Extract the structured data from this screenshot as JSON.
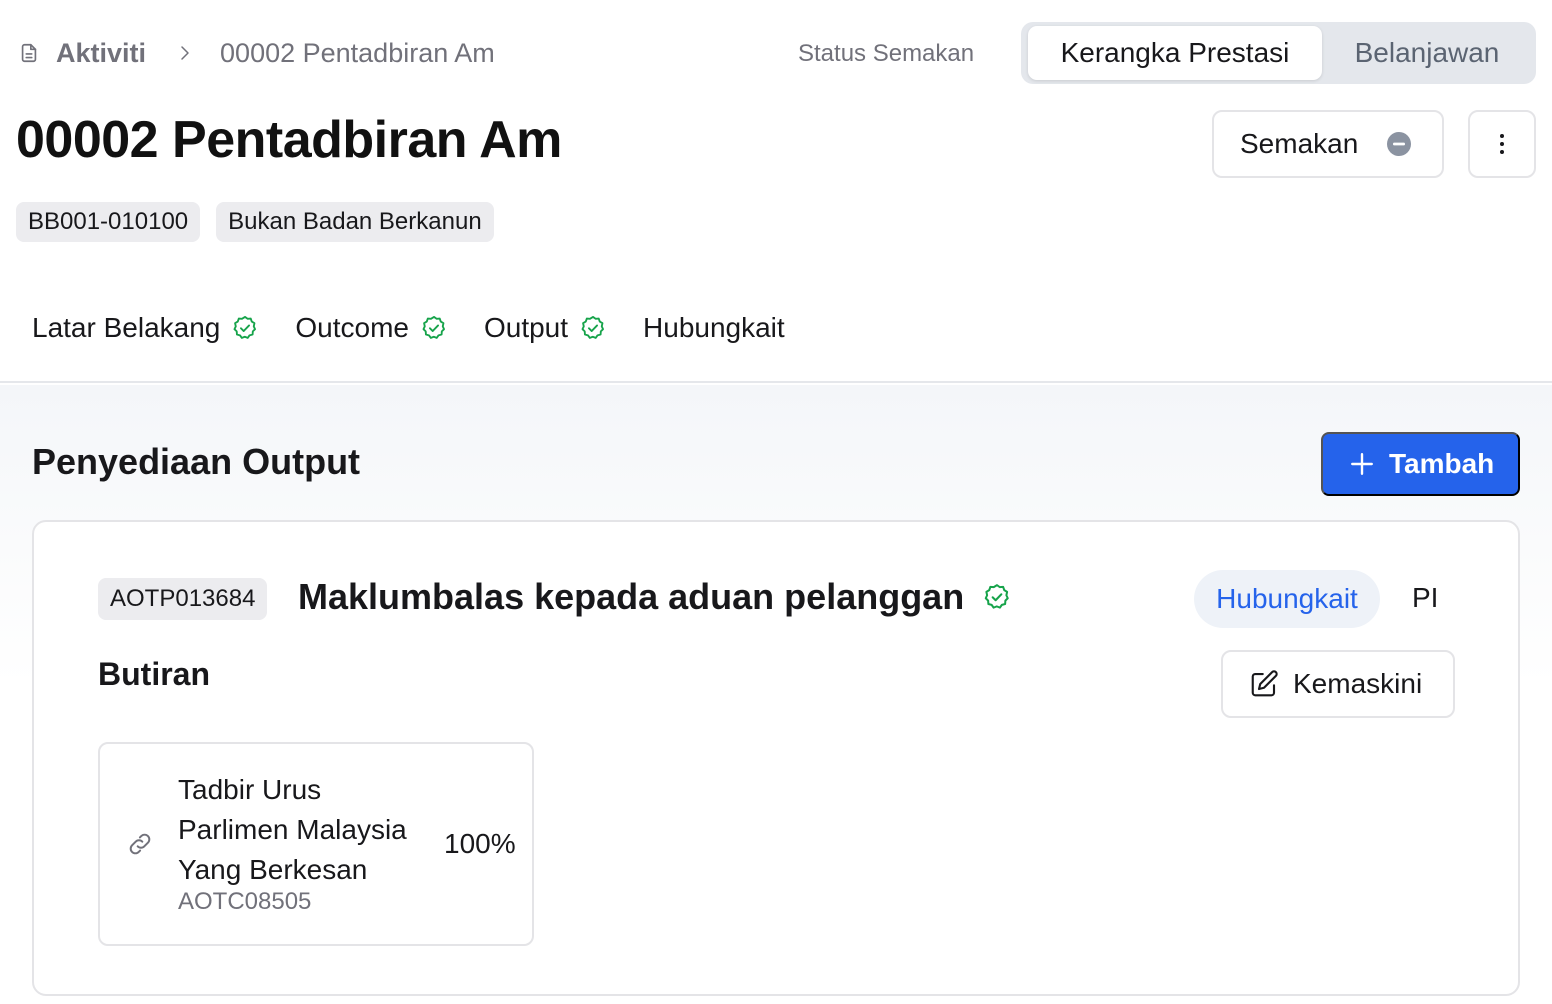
{
  "breadcrumb": {
    "icon": "document-icon",
    "root": "Aktiviti",
    "current": "00002 Pentadbiran Am"
  },
  "header": {
    "status_label": "Status Semakan",
    "segment_tabs": [
      {
        "label": "Kerangka Prestasi",
        "active": true
      },
      {
        "label": "Belanjawan",
        "active": false
      }
    ],
    "title": "00002 Pentadbiran Am",
    "review_button": {
      "label": "Semakan",
      "icon": "minus-circle-icon"
    },
    "more_button_icon": "vertical-dots-icon",
    "tags": [
      "BB001-010100",
      "Bukan Badan Berkanun"
    ]
  },
  "tabs": [
    {
      "label": "Latar Belakang",
      "completed": true
    },
    {
      "label": "Outcome",
      "completed": true
    },
    {
      "label": "Output",
      "completed": true
    },
    {
      "label": "Hubungkait",
      "completed": false
    }
  ],
  "section": {
    "title": "Penyediaan Output",
    "add_button": "Tambah"
  },
  "output_card": {
    "code": "AOTP013684",
    "title": "Maklumbalas kepada aduan pelanggan",
    "completed": true,
    "card_tabs": [
      {
        "label": "Hubungkait",
        "active": true
      },
      {
        "label": "PI",
        "active": false
      }
    ],
    "details_heading": "Butiran",
    "update_button": "Kemaskini",
    "linked_outcome": {
      "name": "Tadbir Urus Parlimen Malaysia Yang Berkesan",
      "code": "AOTC08505",
      "percentage": "100%"
    }
  },
  "colors": {
    "accent": "#2563eb",
    "success": "#16a34a",
    "muted_text": "#71717a",
    "border": "#e4e4e7"
  }
}
